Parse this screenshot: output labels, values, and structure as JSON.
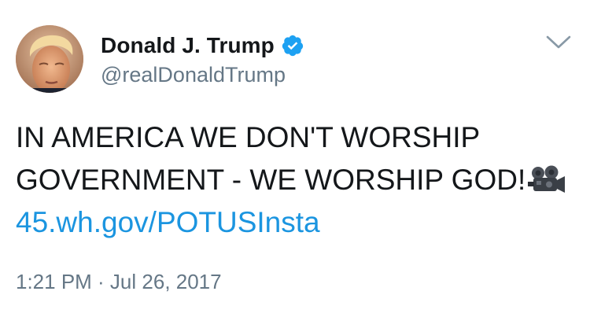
{
  "author": {
    "display_name": "Donald J. Trump",
    "handle": "@realDonaldTrump",
    "verified": true,
    "avatar_icon": "profile-photo"
  },
  "tweet": {
    "line1": "IN AMERICA WE DON'T WORSHIP",
    "line2": "GOVERNMENT - WE WORSHIP GOD!",
    "emoji_icon": "movie-camera-icon",
    "link": "45.wh.gov/POTUSInsta"
  },
  "meta": {
    "timestamp": "1:21 PM · Jul 26, 2017"
  },
  "colors": {
    "link": "#1b95e0",
    "verified_badge": "#1da1f2",
    "secondary_text": "#657786",
    "primary_text": "#14171a"
  }
}
